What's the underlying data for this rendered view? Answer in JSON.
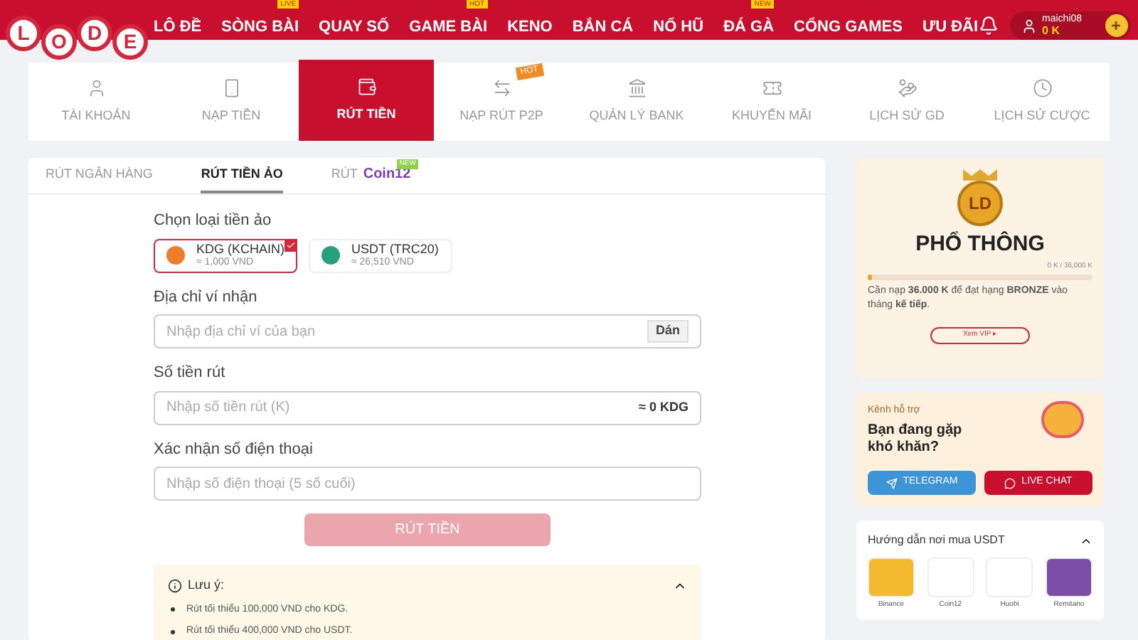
{
  "logo": {
    "letters": [
      "L",
      "O",
      "D",
      "E"
    ]
  },
  "nav": [
    {
      "label": "LÔ ĐỀ"
    },
    {
      "label": "SÒNG BÀI",
      "badge": "LIVE"
    },
    {
      "label": "QUAY SỐ"
    },
    {
      "label": "GAME BÀI",
      "badge": "HOT"
    },
    {
      "label": "KENO"
    },
    {
      "label": "BẮN CÁ"
    },
    {
      "label": "NỔ HŨ"
    },
    {
      "label": "ĐÁ GÀ",
      "badge": "NEW"
    },
    {
      "label": "CỔNG GAMES"
    },
    {
      "label": "ƯU ĐÃI"
    }
  ],
  "user": {
    "name": "maichi08",
    "balance": "0 K",
    "add": "+"
  },
  "account_tabs": [
    {
      "label": "TÀI KHOẢN",
      "kind": "user",
      "selected": false
    },
    {
      "label": "NẠP TIỀN",
      "kind": "deposit",
      "selected": false
    },
    {
      "label": "RÚT TIỀN",
      "kind": "withdraw",
      "selected": true
    },
    {
      "label": "NẠP RÚT P2P",
      "kind": "p2p",
      "selected": false,
      "badge": "HOT"
    },
    {
      "label": "QUẢN LÝ BANK",
      "kind": "bank",
      "selected": false
    },
    {
      "label": "KHUYẾN MÃI",
      "kind": "promo",
      "selected": false
    },
    {
      "label": "LỊCH SỬ GD",
      "kind": "history",
      "selected": false
    },
    {
      "label": "LỊCH SỬ CƯỢC",
      "kind": "clock",
      "selected": false
    }
  ],
  "withdraw_tabs": [
    {
      "label": "RÚT NGÂN HÀNG",
      "selected": false
    },
    {
      "label": "RÚT TIỀN ẢO",
      "selected": true
    },
    {
      "label": "RÚT",
      "brand": "Coin12",
      "badge": "NEW",
      "selected": false
    }
  ],
  "form": {
    "coin_label": "Chọn loại tiền ảo",
    "coins": [
      {
        "name": "KDG (KCHAIN)",
        "rate": "≈ 1,000 VND",
        "color": "#ee7d2b",
        "selected": true
      },
      {
        "name": "USDT (TRC20)",
        "rate": "≈ 26,510 VND",
        "color": "#26a17b",
        "selected": false
      }
    ],
    "address": {
      "label": "Địa chỉ ví nhận",
      "placeholder": "Nhập địa chỉ ví của bạn",
      "paste": "Dán"
    },
    "amount": {
      "label": "Số tiền rút",
      "placeholder": "Nhập số tiền rút (K)",
      "estimate": "≈ 0 KDG"
    },
    "phone": {
      "label": "Xác nhận số điện thoại",
      "placeholder": "Nhập số điện thoại (5 số cuối)"
    },
    "submit": {
      "label": "RÚT TIỀN",
      "disabled": true
    },
    "note": {
      "title": "Lưu ý:",
      "expanded": true,
      "items": [
        "Rút tối thiểu 100,000 VND cho KDG.",
        "Rút tối thiểu 400,000 VND cho USDT."
      ]
    }
  },
  "vip": {
    "badge": "LD",
    "tier": "PHỔ THÔNG",
    "progress_text": "0 K / 36,000 K",
    "level": 0,
    "message": "Cần nạp **36.000 K** để đạt hạng **BRONZE** vào tháng **kế tiếp**.",
    "button": "Xem VIP ▸"
  },
  "support": {
    "caption": "Kênh hỗ trợ",
    "title": "Bạn đang gặp khó khăn?",
    "buttons": [
      {
        "label": "TELEGRAM",
        "kind": "telegram"
      },
      {
        "label": "LIVE CHAT",
        "kind": "chat"
      }
    ]
  },
  "guide": {
    "title": "Hướng dẫn nơi mua USDT",
    "expanded": true,
    "exchanges": [
      {
        "name": "Binance",
        "color": "#f3ba2f"
      },
      {
        "name": "Coin12",
        "color": "#ffffff"
      },
      {
        "name": "Huobi",
        "color": "#ffffff"
      },
      {
        "name": "Remitano",
        "color": "#7b4fa6"
      }
    ]
  }
}
